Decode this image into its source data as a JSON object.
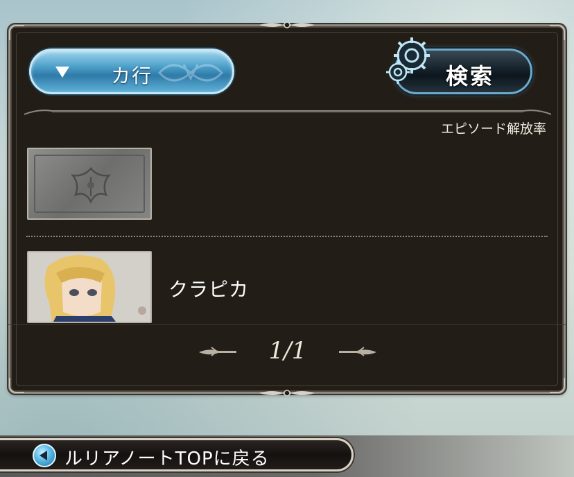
{
  "filter": {
    "kana_label": "カ行",
    "search_label": "検索"
  },
  "list": {
    "header_label": "エピソード解放率",
    "items": [
      {
        "name": "",
        "locked": true
      },
      {
        "name": "クラピカ",
        "locked": false
      }
    ]
  },
  "pager": {
    "text": "1/1"
  },
  "footer": {
    "back_label": "ルリアノートTOPに戻る"
  },
  "colors": {
    "panel_bg": "#231d17",
    "accent_blue": "#4a9dc7",
    "text_light": "#f2ede3"
  }
}
